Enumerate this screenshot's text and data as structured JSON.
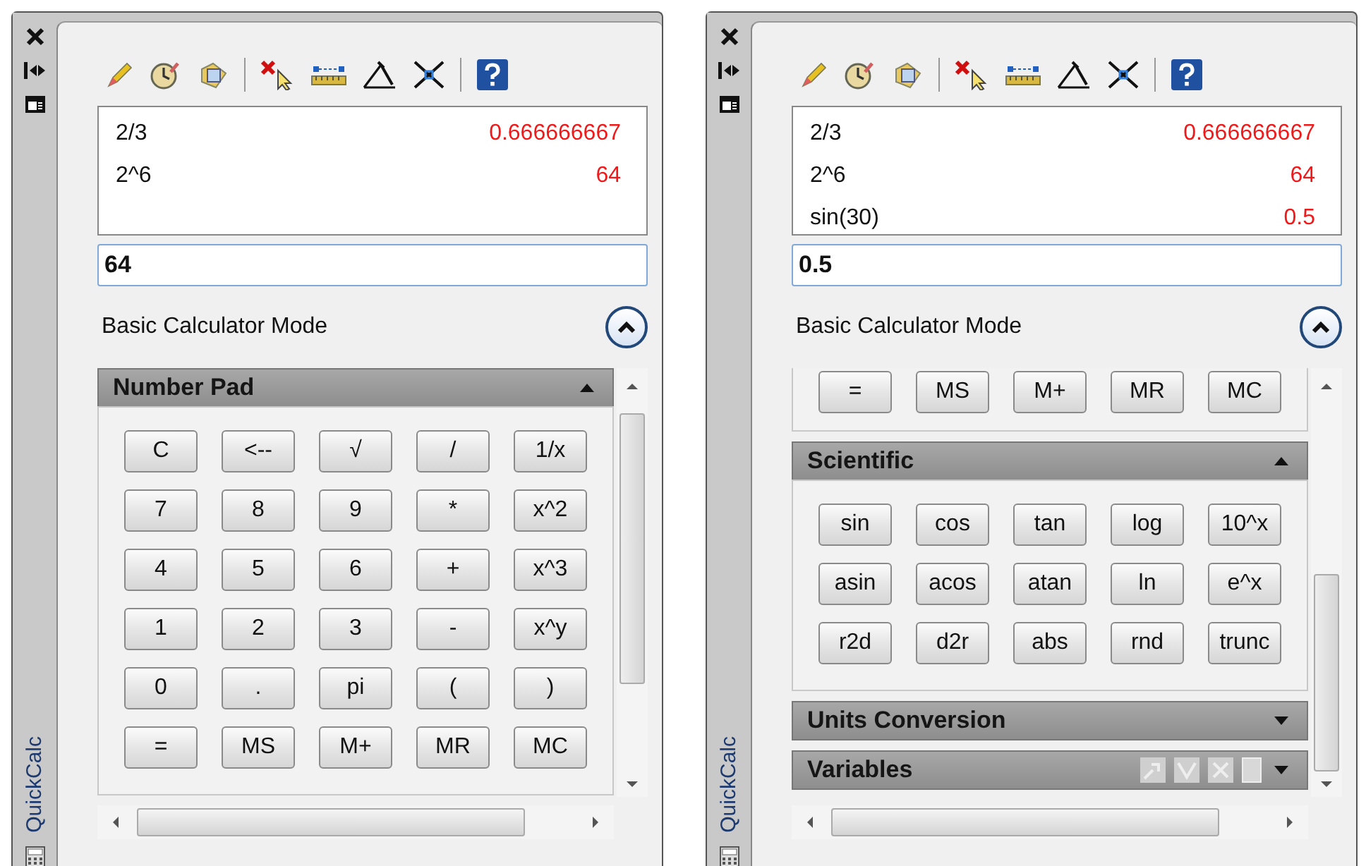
{
  "panels": [
    {
      "title": "QuickCalc",
      "history": [
        {
          "expression": "2/3",
          "result": "0.666666667"
        },
        {
          "expression": "2^6",
          "result": "64"
        }
      ],
      "input": {
        "value": "64"
      },
      "mode_label": "Basic Calculator Mode",
      "sections": [
        {
          "kind": "pad",
          "title": "Number Pad",
          "expanded": true,
          "buttons": [
            "C",
            "<--",
            "√",
            "/",
            "1/x",
            "7",
            "8",
            "9",
            "*",
            "x^2",
            "4",
            "5",
            "6",
            "+",
            "x^3",
            "1",
            "2",
            "3",
            "-",
            "x^y",
            "0",
            ".",
            "pi",
            "(",
            ")",
            "=",
            "MS",
            "M+",
            "MR",
            "MC"
          ]
        }
      ]
    },
    {
      "title": "QuickCalc",
      "history": [
        {
          "expression": "2/3",
          "result": "0.666666667"
        },
        {
          "expression": "2^6",
          "result": "64"
        },
        {
          "expression": "sin(30)",
          "result": "0.5"
        }
      ],
      "input": {
        "value": "0.5"
      },
      "mode_label": "Basic Calculator Mode",
      "sections": [
        {
          "kind": "pad-tail",
          "buttons": [
            "=",
            "MS",
            "M+",
            "MR",
            "MC"
          ]
        },
        {
          "kind": "pad",
          "title": "Scientific",
          "expanded": true,
          "buttons": [
            "sin",
            "cos",
            "tan",
            "log",
            "10^x",
            "asin",
            "acos",
            "atan",
            "ln",
            "e^x",
            "r2d",
            "d2r",
            "abs",
            "rnd",
            "trunc"
          ]
        },
        {
          "kind": "pad",
          "title": "Units Conversion",
          "expanded": false
        },
        {
          "kind": "variables",
          "title": "Variables",
          "expanded": false
        }
      ]
    }
  ]
}
